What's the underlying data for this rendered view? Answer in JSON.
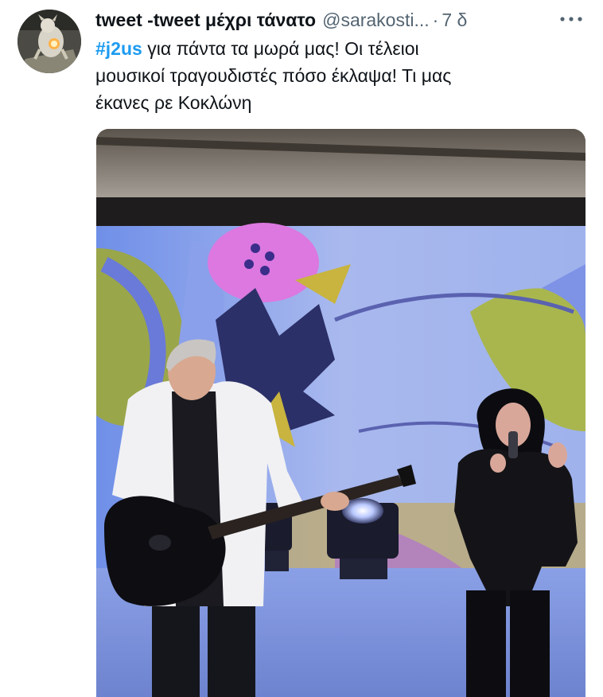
{
  "tweet": {
    "display_name": "tweet -tweet μέχρι τάνατο",
    "handle": "@sarakosti...",
    "separator": "·",
    "time": "7 δ",
    "more_icon": "more-horizontal-icon",
    "text": {
      "hashtag": "#j2us",
      "line1_rest": " για πάντα τα μωρά μας! Οι τέλειοι",
      "line2": "μουσικοί τραγουδιστές πόσο έκλαψα! Τι μας",
      "line3": "έκανες ρε Κοκλώνη"
    },
    "colors": {
      "hashtag": "#1d9bf0",
      "secondary_text": "#536471",
      "primary_text": "#0f1419"
    }
  }
}
